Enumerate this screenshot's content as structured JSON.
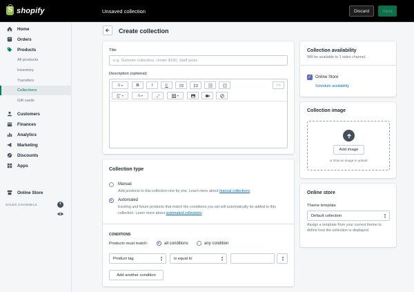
{
  "topbar": {
    "brand": "shopify",
    "status": "Unsaved collection",
    "discard_label": "Discard",
    "save_label": "Save"
  },
  "sidebar": {
    "items": [
      {
        "label": "Home",
        "icon": "home-icon"
      },
      {
        "label": "Orders",
        "icon": "orders-icon"
      },
      {
        "label": "Products",
        "icon": "tag-icon"
      },
      {
        "label": "All products"
      },
      {
        "label": "Inventory"
      },
      {
        "label": "Transfers"
      },
      {
        "label": "Collections"
      },
      {
        "label": "Gift cards"
      },
      {
        "label": "Customers",
        "icon": "customers-icon"
      },
      {
        "label": "Finances",
        "icon": "finances-icon"
      },
      {
        "label": "Analytics",
        "icon": "analytics-icon"
      },
      {
        "label": "Marketing",
        "icon": "marketing-icon"
      },
      {
        "label": "Discounts",
        "icon": "discounts-icon"
      },
      {
        "label": "Apps",
        "icon": "apps-icon"
      }
    ],
    "channels_title": "SALES CHANNELS",
    "online_store": "Online Store",
    "add_channel_icon": "+"
  },
  "page": {
    "title": "Create collection"
  },
  "form": {
    "title_label": "Title",
    "title_placeholder": "e.g. Summer collection, Under $100, Staff picks",
    "description_label": "Description (optional)",
    "toolbar": {
      "paragraph": "A",
      "bold": "B",
      "italic": "I",
      "underline": "U",
      "text_color": "A",
      "code": "<>"
    }
  },
  "collection_type": {
    "title": "Collection type",
    "manual_label": "Manual",
    "manual_help": "Add products to this collection one by one. Learn more about ",
    "manual_link": "manual collections",
    "automated_label": "Automated",
    "automated_help": "Existing and future products that match the conditions you set will automatically be added to this collection. Learn more about ",
    "automated_link": "automated collections",
    "selected": "Automated"
  },
  "conditions": {
    "title": "CONDITIONS",
    "match_label": "Products must match:",
    "all_label": "all conditions",
    "any_label": "any condition",
    "selected": "all conditions",
    "field": "Product tag",
    "operator": "is equal to",
    "value": "",
    "add_label": "Add another condition"
  },
  "availability": {
    "title": "Collection availability",
    "subtitle": "Will be available to 1 sales channel.",
    "channel": "Online Store",
    "channel_checked": true,
    "schedule_link": "Schedule availability"
  },
  "image": {
    "title": "Collection image",
    "add_label": "Add image",
    "drop_hint": "or drop an image to upload"
  },
  "online_store": {
    "title": "Online store",
    "template_label": "Theme template",
    "template_value": "Default collection",
    "template_help": "Assign a template from your current theme to define how the collection is displayed."
  },
  "colors": {
    "topbar": "#000000",
    "accent": "#5c6ac4",
    "active_nav": "#008060",
    "link": "#006fbb"
  }
}
